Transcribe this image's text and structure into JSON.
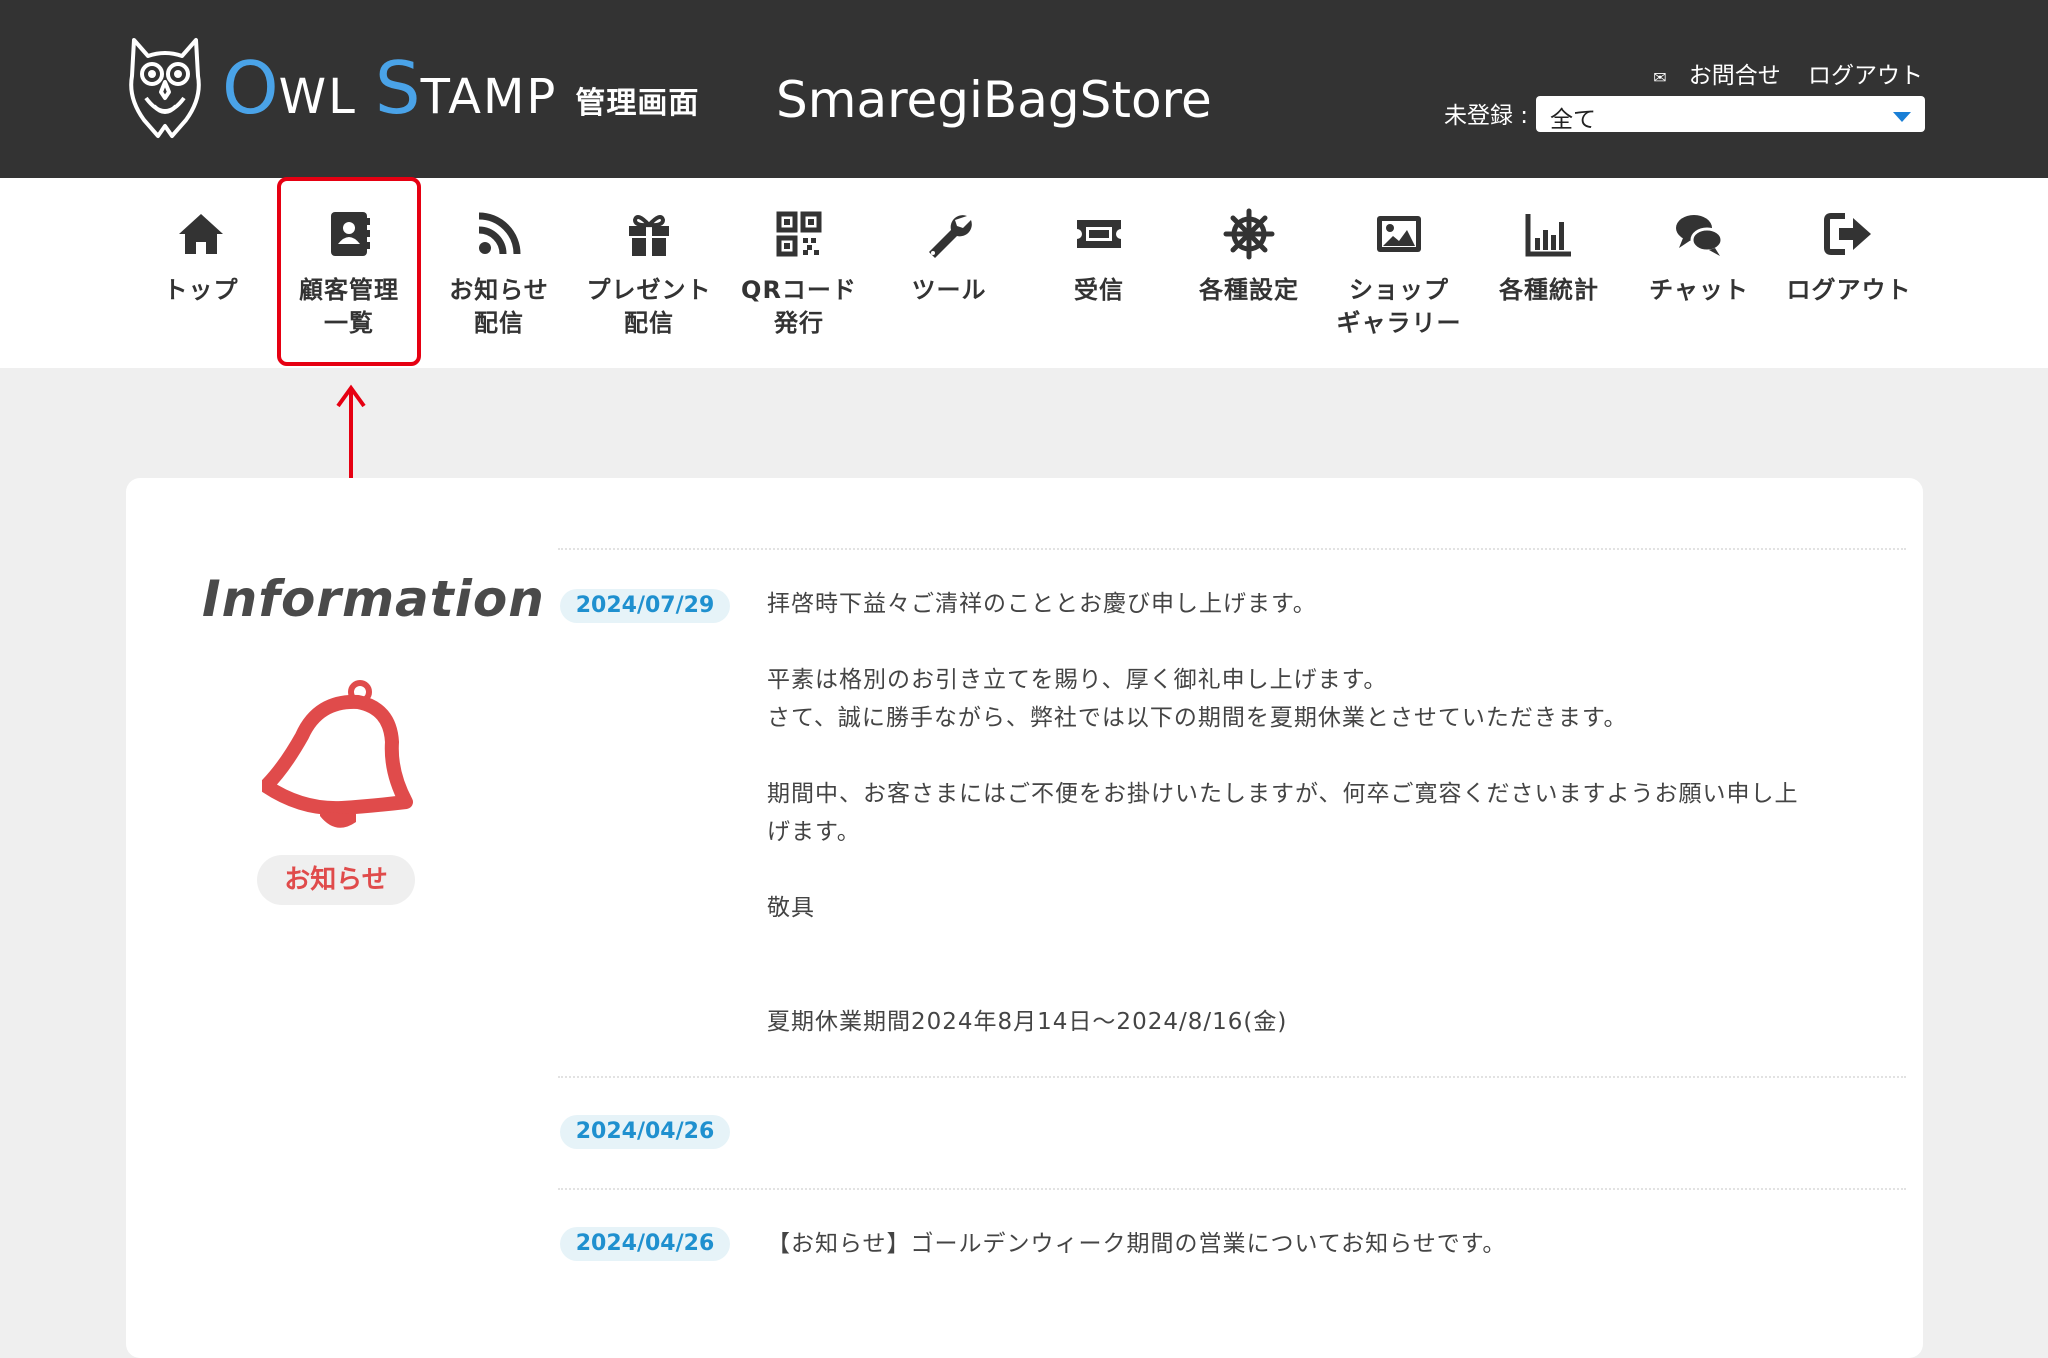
{
  "header": {
    "brand_o": "O",
    "brand_wl": "WL",
    "brand_s": "S",
    "brand_tamp": "TAMP",
    "brand_suffix": "管理画面",
    "store_name": "SmaregiBagStore",
    "contact_label": "お問合せ",
    "logout_label": "ログアウト",
    "filter_label": "未登録 :",
    "filter_value": "全て"
  },
  "nav": {
    "items": [
      {
        "line1": "トップ",
        "line2": "",
        "icon": "home-icon"
      },
      {
        "line1": "顧客管理",
        "line2": "一覧",
        "icon": "address-book-icon"
      },
      {
        "line1": "お知らせ",
        "line2": "配信",
        "icon": "rss-icon"
      },
      {
        "line1": "プレゼント",
        "line2": "配信",
        "icon": "gift-icon"
      },
      {
        "line1": "QRコード",
        "line2": "発行",
        "icon": "qrcode-icon"
      },
      {
        "line1": "ツール",
        "line2": "",
        "icon": "wrench-icon"
      },
      {
        "line1": "受信",
        "line2": "",
        "icon": "ticket-icon"
      },
      {
        "line1": "各種設定",
        "line2": "",
        "icon": "ship-wheel-icon"
      },
      {
        "line1": "ショップ",
        "line2": "ギャラリー",
        "icon": "image-icon"
      },
      {
        "line1": "各種統計",
        "line2": "",
        "icon": "bar-chart-icon"
      },
      {
        "line1": "チャット",
        "line2": "",
        "icon": "chat-bubbles-icon"
      },
      {
        "line1": "ログアウト",
        "line2": "",
        "icon": "sign-out-icon"
      }
    ]
  },
  "info": {
    "title": "Information",
    "badge": "お知らせ",
    "posts": [
      {
        "date": "2024/07/29",
        "lines": [
          "拝啓時下益々ご清祥のこととお慶び申し上げます。",
          "",
          "平素は格別のお引き立てを賜り、厚く御礼申し上げます。",
          "さて、誠に勝手ながら、弊社では以下の期間を夏期休業とさせていただきます。",
          "",
          "期間中、お客さまにはご不便をお掛けいたしますが、何卒ご寛容くださいますようお願い申し上",
          "げます。",
          "",
          "敬具",
          "",
          "",
          "夏期休業期間2024年8月14日〜2024/8/16(金)"
        ]
      },
      {
        "date": "2024/04/26",
        "lines": []
      },
      {
        "date": "2024/04/26",
        "lines": [
          "【お知らせ】ゴールデンウィーク期間の営業についてお知らせです。"
        ]
      }
    ]
  },
  "colors": {
    "header_bg": "#333333",
    "brand_blue": "#4aa3e8",
    "highlight_red": "#e60012",
    "bell_red": "#e04b4b",
    "date_blue": "#1f90cf"
  }
}
